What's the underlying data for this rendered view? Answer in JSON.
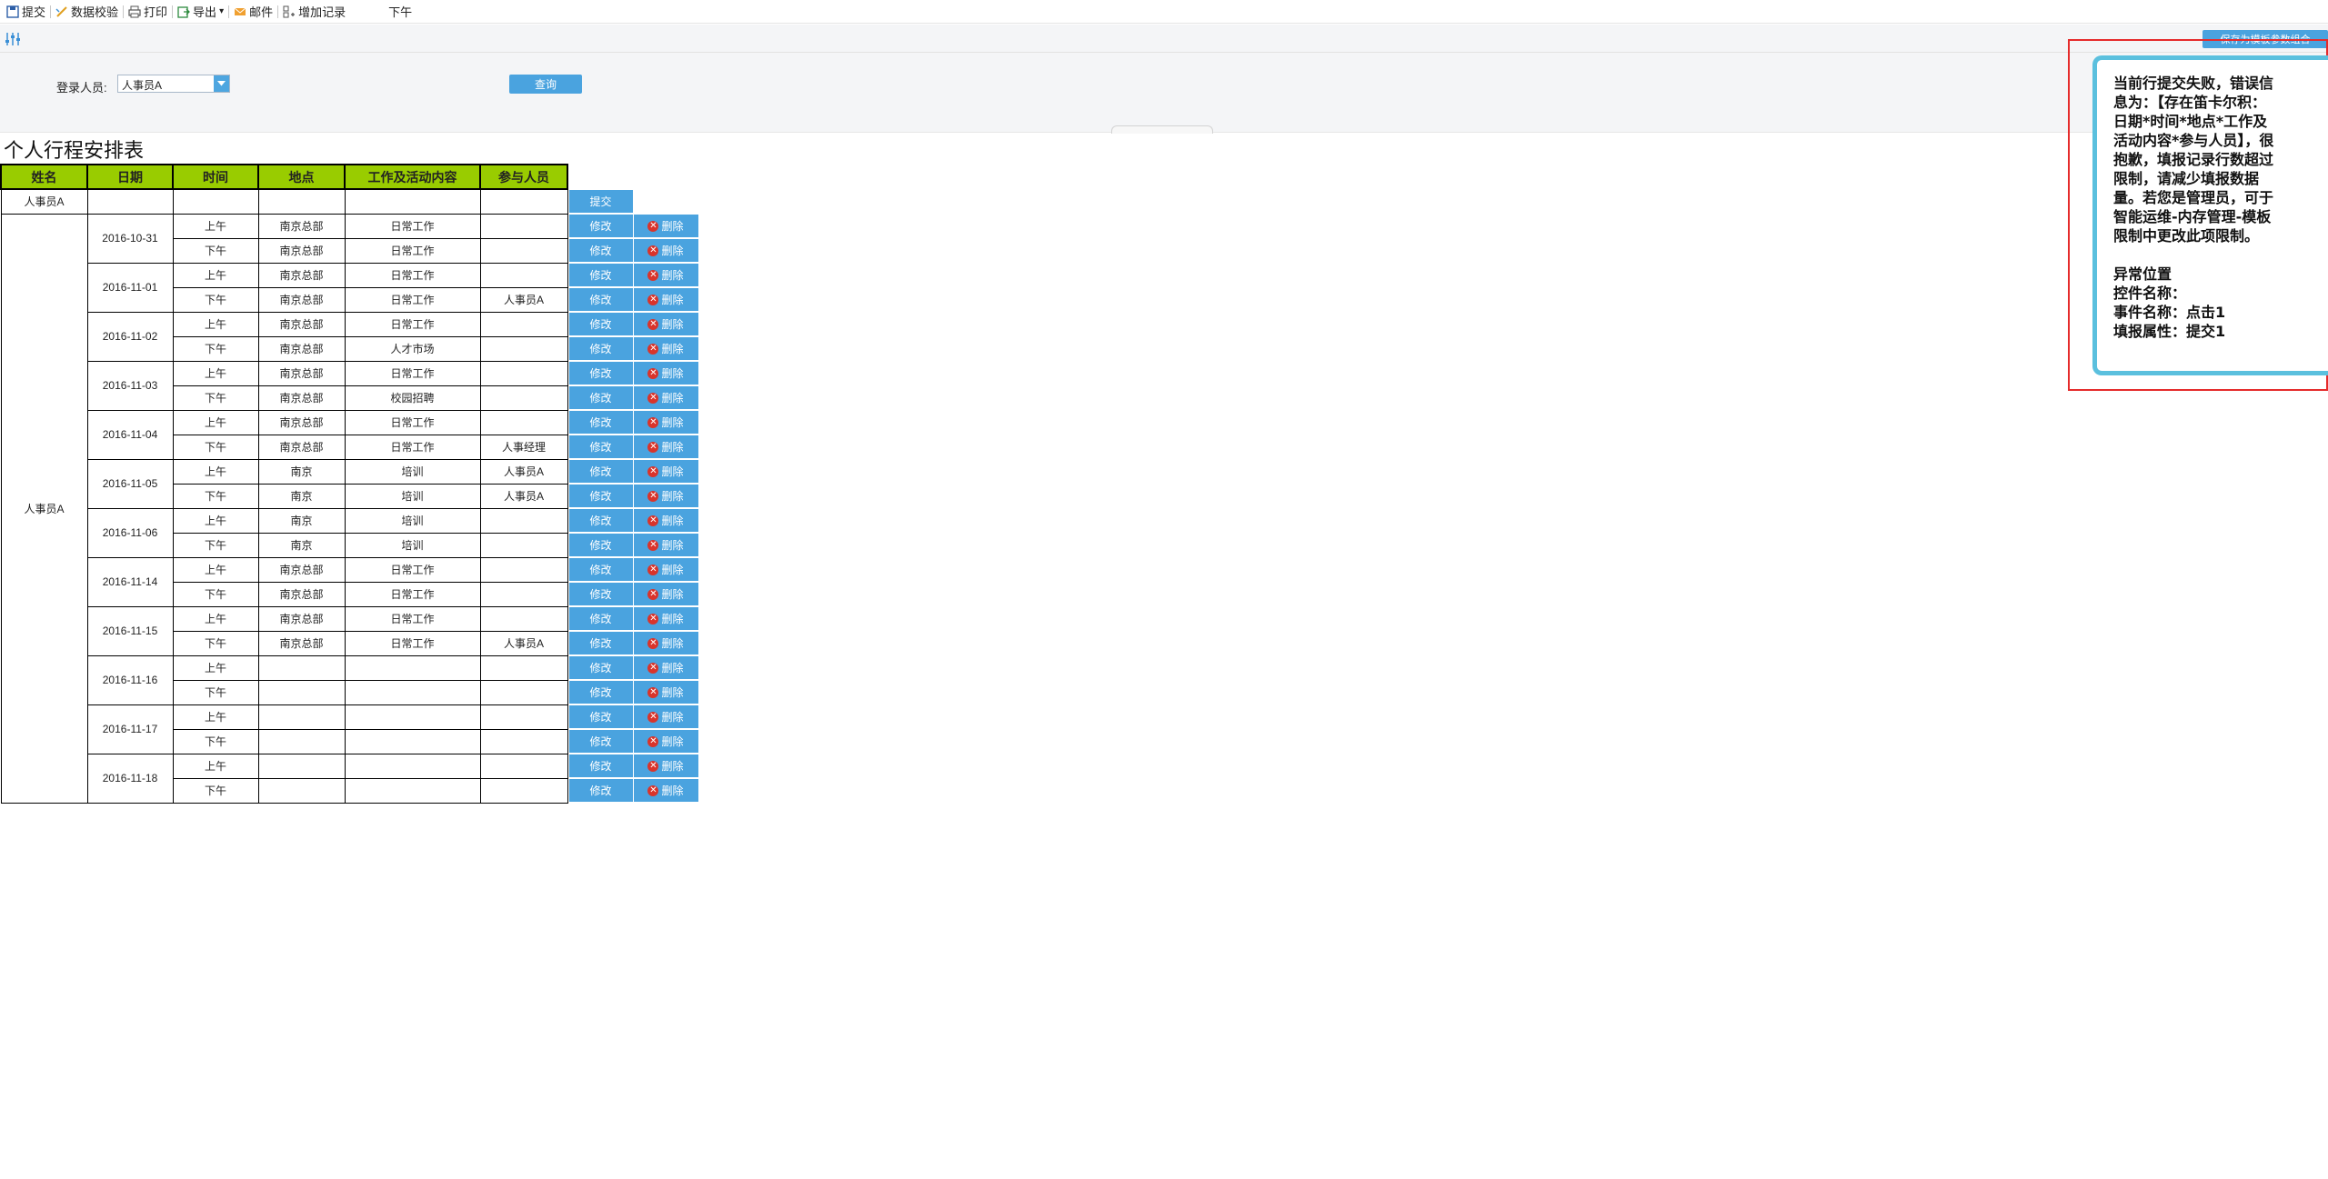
{
  "toolbar": {
    "items": [
      {
        "label": "提交",
        "icon": "save-icon"
      },
      {
        "label": "数据校验",
        "icon": "validate-icon"
      },
      {
        "label": "打印",
        "icon": "print-icon"
      },
      {
        "label": "导出",
        "icon": "export-icon"
      },
      {
        "label": "邮件",
        "icon": "mail-icon"
      },
      {
        "label": "增加记录",
        "icon": "add-record-icon"
      }
    ],
    "extra_text": "下午"
  },
  "params": {
    "login_label": "登录人员:",
    "login_value": "人事员A",
    "query_label": "查询",
    "save_param_label": "保存为模板参数组合"
  },
  "report": {
    "title": "个人行程安排表",
    "headers": [
      "姓名",
      "日期",
      "时间",
      "地点",
      "工作及活动内容",
      "参与人员"
    ],
    "submit_row": {
      "name": "人事员A",
      "submit_label": "提交"
    },
    "group_name": "人事员A",
    "edit_label": "修改",
    "delete_label": "删除",
    "days": [
      {
        "date": "2016-10-31",
        "rows": [
          {
            "time": "上午",
            "place": "南京总部",
            "work": "日常工作",
            "who": ""
          },
          {
            "time": "下午",
            "place": "南京总部",
            "work": "日常工作",
            "who": ""
          }
        ]
      },
      {
        "date": "2016-11-01",
        "rows": [
          {
            "time": "上午",
            "place": "南京总部",
            "work": "日常工作",
            "who": ""
          },
          {
            "time": "下午",
            "place": "南京总部",
            "work": "日常工作",
            "who": "人事员A"
          }
        ]
      },
      {
        "date": "2016-11-02",
        "rows": [
          {
            "time": "上午",
            "place": "南京总部",
            "work": "日常工作",
            "who": ""
          },
          {
            "time": "下午",
            "place": "南京总部",
            "work": "人才市场",
            "who": ""
          }
        ]
      },
      {
        "date": "2016-11-03",
        "rows": [
          {
            "time": "上午",
            "place": "南京总部",
            "work": "日常工作",
            "who": ""
          },
          {
            "time": "下午",
            "place": "南京总部",
            "work": "校园招聘",
            "who": ""
          }
        ]
      },
      {
        "date": "2016-11-04",
        "rows": [
          {
            "time": "上午",
            "place": "南京总部",
            "work": "日常工作",
            "who": ""
          },
          {
            "time": "下午",
            "place": "南京总部",
            "work": "日常工作",
            "who": "人事经理"
          }
        ]
      },
      {
        "date": "2016-11-05",
        "rows": [
          {
            "time": "上午",
            "place": "南京",
            "work": "培训",
            "who": "人事员A"
          },
          {
            "time": "下午",
            "place": "南京",
            "work": "培训",
            "who": "人事员A"
          }
        ]
      },
      {
        "date": "2016-11-06",
        "rows": [
          {
            "time": "上午",
            "place": "南京",
            "work": "培训",
            "who": ""
          },
          {
            "time": "下午",
            "place": "南京",
            "work": "培训",
            "who": ""
          }
        ]
      },
      {
        "date": "2016-11-14",
        "rows": [
          {
            "time": "上午",
            "place": "南京总部",
            "work": "日常工作",
            "who": ""
          },
          {
            "time": "下午",
            "place": "南京总部",
            "work": "日常工作",
            "who": ""
          }
        ]
      },
      {
        "date": "2016-11-15",
        "rows": [
          {
            "time": "上午",
            "place": "南京总部",
            "work": "日常工作",
            "who": ""
          },
          {
            "time": "下午",
            "place": "南京总部",
            "work": "日常工作",
            "who": "人事员A"
          }
        ]
      },
      {
        "date": "2016-11-16",
        "rows": [
          {
            "time": "上午",
            "place": "",
            "work": "",
            "who": ""
          },
          {
            "time": "下午",
            "place": "",
            "work": "",
            "who": ""
          }
        ]
      },
      {
        "date": "2016-11-17",
        "rows": [
          {
            "time": "上午",
            "place": "",
            "work": "",
            "who": ""
          },
          {
            "time": "下午",
            "place": "",
            "work": "",
            "who": ""
          }
        ]
      },
      {
        "date": "2016-11-18",
        "rows": [
          {
            "time": "上午",
            "place": "",
            "work": "",
            "who": ""
          },
          {
            "time": "下午",
            "place": "",
            "work": "",
            "who": ""
          }
        ]
      }
    ]
  },
  "error_dialog": {
    "message": "当前行提交失败，错误信息为：【存在笛卡尔积：日期*时间*地点*工作及活动内容*参与人员】，很抱歉，填报记录行数超过限制，请减少填报数据量。若您是管理员，可于智能运维-内存管理-模板限制中更改此项限制。\n\n异常位置\n控件名称：\n事件名称：点击1\n填报属性：提交1"
  }
}
